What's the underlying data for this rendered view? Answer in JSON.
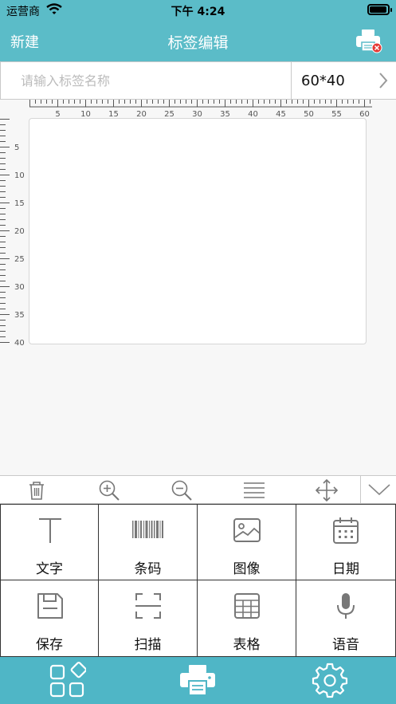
{
  "status_bar": {
    "carrier": "运营商",
    "time": "下午 4:24"
  },
  "nav": {
    "left_label": "新建",
    "title": "标签编辑"
  },
  "label_name": {
    "placeholder": "请输入标签名称",
    "value": ""
  },
  "label_size": {
    "value": "60*40"
  },
  "ruler": {
    "h_labels": [
      "5",
      "10",
      "15",
      "20",
      "25",
      "30",
      "35",
      "40",
      "45",
      "50",
      "55",
      "60"
    ],
    "v_labels": [
      "5",
      "10",
      "15",
      "20",
      "25",
      "30",
      "35",
      "40"
    ]
  },
  "toolbar": {
    "icons": [
      "trash-icon",
      "zoom-in-icon",
      "zoom-out-icon",
      "align-icon",
      "move-icon",
      "chevron-down-icon"
    ]
  },
  "tools": [
    {
      "label": "文字",
      "icon": "text-icon"
    },
    {
      "label": "条码",
      "icon": "barcode-icon"
    },
    {
      "label": "图像",
      "icon": "image-icon"
    },
    {
      "label": "日期",
      "icon": "calendar-icon"
    },
    {
      "label": "保存",
      "icon": "save-icon"
    },
    {
      "label": "扫描",
      "icon": "scan-icon"
    },
    {
      "label": "表格",
      "icon": "table-icon"
    },
    {
      "label": "语音",
      "icon": "microphone-icon"
    }
  ],
  "tabbar": {
    "icons": [
      "templates-icon",
      "print-icon",
      "settings-icon"
    ]
  },
  "colors": {
    "header": "#5bbcc8",
    "tabbar": "#4fb6c6",
    "icon_gray": "#777777"
  }
}
